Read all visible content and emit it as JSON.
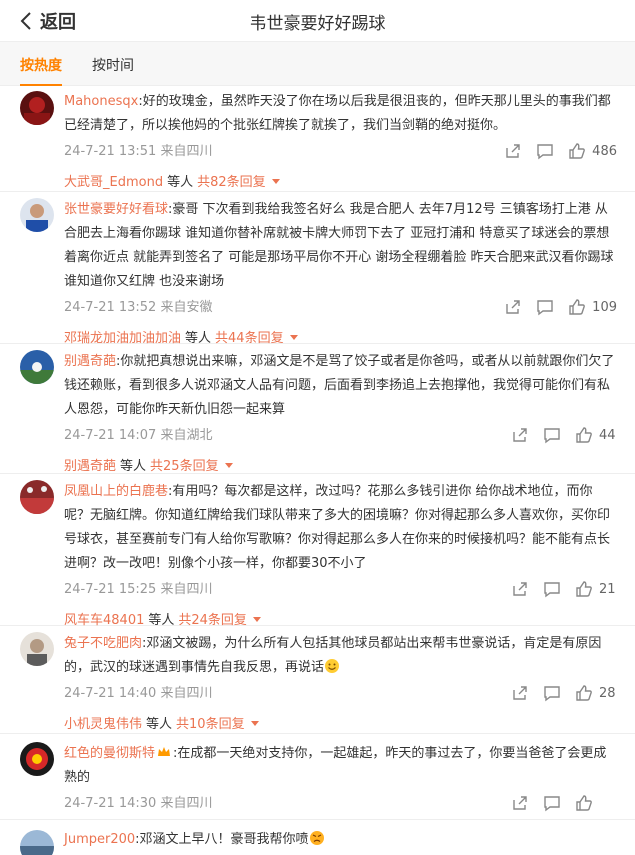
{
  "header": {
    "back_label": "返回",
    "title": "韦世豪要好好踢球"
  },
  "sort_tabs": [
    {
      "label": "按热度",
      "active": true
    },
    {
      "label": "按时间",
      "active": false
    }
  ],
  "comments": [
    {
      "user": "Mahonesqx",
      "text": ":好的玫瑰金，虽然昨天没了你在场以后我是很沮丧的，但昨天那儿里头的事我们都已经清楚了，所以挨他妈的个批张红牌挨了就挨了，我们当剑鞘的绝对挺你。",
      "time": "24-7-21 13:51 来自四川",
      "likes": "486",
      "reply_user": "大武哥_Edmond",
      "reply_others": "等人",
      "reply_total": "共82条回复"
    },
    {
      "user": "张世豪要好好看球",
      "text": ":豪哥 下次看到我给我签名好么 我是合肥人 去年7月12号 三镇客场打上港 从合肥去上海看你踢球 谁知道你替补席就被卡牌大师罚下去了 亚冠打浦和 特意买了球迷会的票想着离你近点 就能弄到签名了 可能是那场平局你不开心 谢场全程绷着脸 昨天合肥来武汉看你踢球 谁知道你又红牌 也没来谢场",
      "time": "24-7-21 13:52 来自安徽",
      "likes": "109",
      "reply_user": "邓瑞龙加油加油加油",
      "reply_others": "等人",
      "reply_total": "共44条回复"
    },
    {
      "user": "别遇奇葩",
      "text": ":你就把真想说出来嘛，邓涵文是不是骂了饺子或者是你爸吗，或者从以前就跟你们欠了钱还赖账，看到很多人说邓涵文人品有问题，后面看到李扬追上去抱撑他，我觉得可能你们有私人恩怨，可能你昨天新仇旧怨一起来算",
      "time": "24-7-21 14:07 来自湖北",
      "likes": "44",
      "reply_user": "别遇奇葩",
      "reply_others": "等人",
      "reply_total": "共25条回复"
    },
    {
      "user": "凤凰山上的白鹿巷",
      "text": ":有用吗？每次都是这样，改过吗？花那么多钱引进你 给你战术地位，而你呢？无脑红牌。你知道红牌给我们球队带来了多大的困境嘛？你对得起那么多人喜欢你，买你印号球衣，甚至赛前专门有人给你写歌嘛？你对得起那么多人在你来的时候接机吗？能不能有点长进啊？改一改吧！别像个小孩一样，你都要30不小了",
      "time": "24-7-21 15:25 来自四川",
      "likes": "21",
      "reply_user": "风车车48401",
      "reply_others": "等人",
      "reply_total": "共24条回复"
    },
    {
      "user": "兔子不吃肥肉",
      "text": ":邓涵文被踢，为什么所有人包括其他球员都站出来帮韦世豪说话，肯定是有原因的，武汉的球迷遇到事情先自我反思，再说话",
      "emoji": "smile-emoji",
      "time": "24-7-21 14:40 来自四川",
      "likes": "28",
      "reply_user": "小机灵鬼伟伟",
      "reply_others": "等人",
      "reply_total": "共10条回复"
    },
    {
      "user": "红色的曼彻斯特",
      "badge": "crown-icon",
      "text": ":在成都一天绝对支持你，一起雄起，昨天的事过去了，你要当爸爸了会更成熟的",
      "time": "24-7-21 14:30 来自四川",
      "likes": ""
    },
    {
      "user": "Jumper200",
      "text": ":邓涵文上早八！豪哥我帮你喷",
      "emoji": "angry-emoji"
    }
  ],
  "colors": {
    "accent": "#ff8200",
    "username": "#eb7350",
    "time": "#999999"
  }
}
